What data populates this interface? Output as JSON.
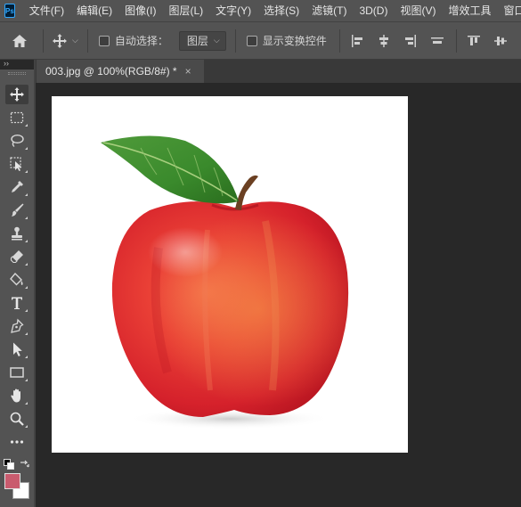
{
  "app": {
    "logo_text": "Ps"
  },
  "menu": [
    "文件(F)",
    "编辑(E)",
    "图像(I)",
    "图层(L)",
    "文字(Y)",
    "选择(S)",
    "滤镜(T)",
    "3D(D)",
    "视图(V)",
    "增效工具",
    "窗口(W)"
  ],
  "options": {
    "auto_select_label": "自动选择：",
    "auto_select_value": "图层",
    "show_transform_label": "显示变换控件"
  },
  "document": {
    "tab_title": "003.jpg @ 100%(RGB/8#) *",
    "close_glyph": "×"
  },
  "toolbar": {
    "collapse_glyph": "››",
    "tools": [
      "move",
      "marquee",
      "lasso",
      "object-select",
      "eyedropper",
      "brush",
      "clone-stamp",
      "eraser",
      "paint-bucket",
      "type",
      "pen",
      "path-select",
      "rectangle",
      "hand",
      "zoom",
      "more"
    ]
  },
  "colors": {
    "foreground": "#c95b6e",
    "background": "#ffffff",
    "ui_bg": "#535353",
    "canvas_bg": "#282828"
  },
  "image": {
    "subject": "red-apple-with-leaf"
  }
}
